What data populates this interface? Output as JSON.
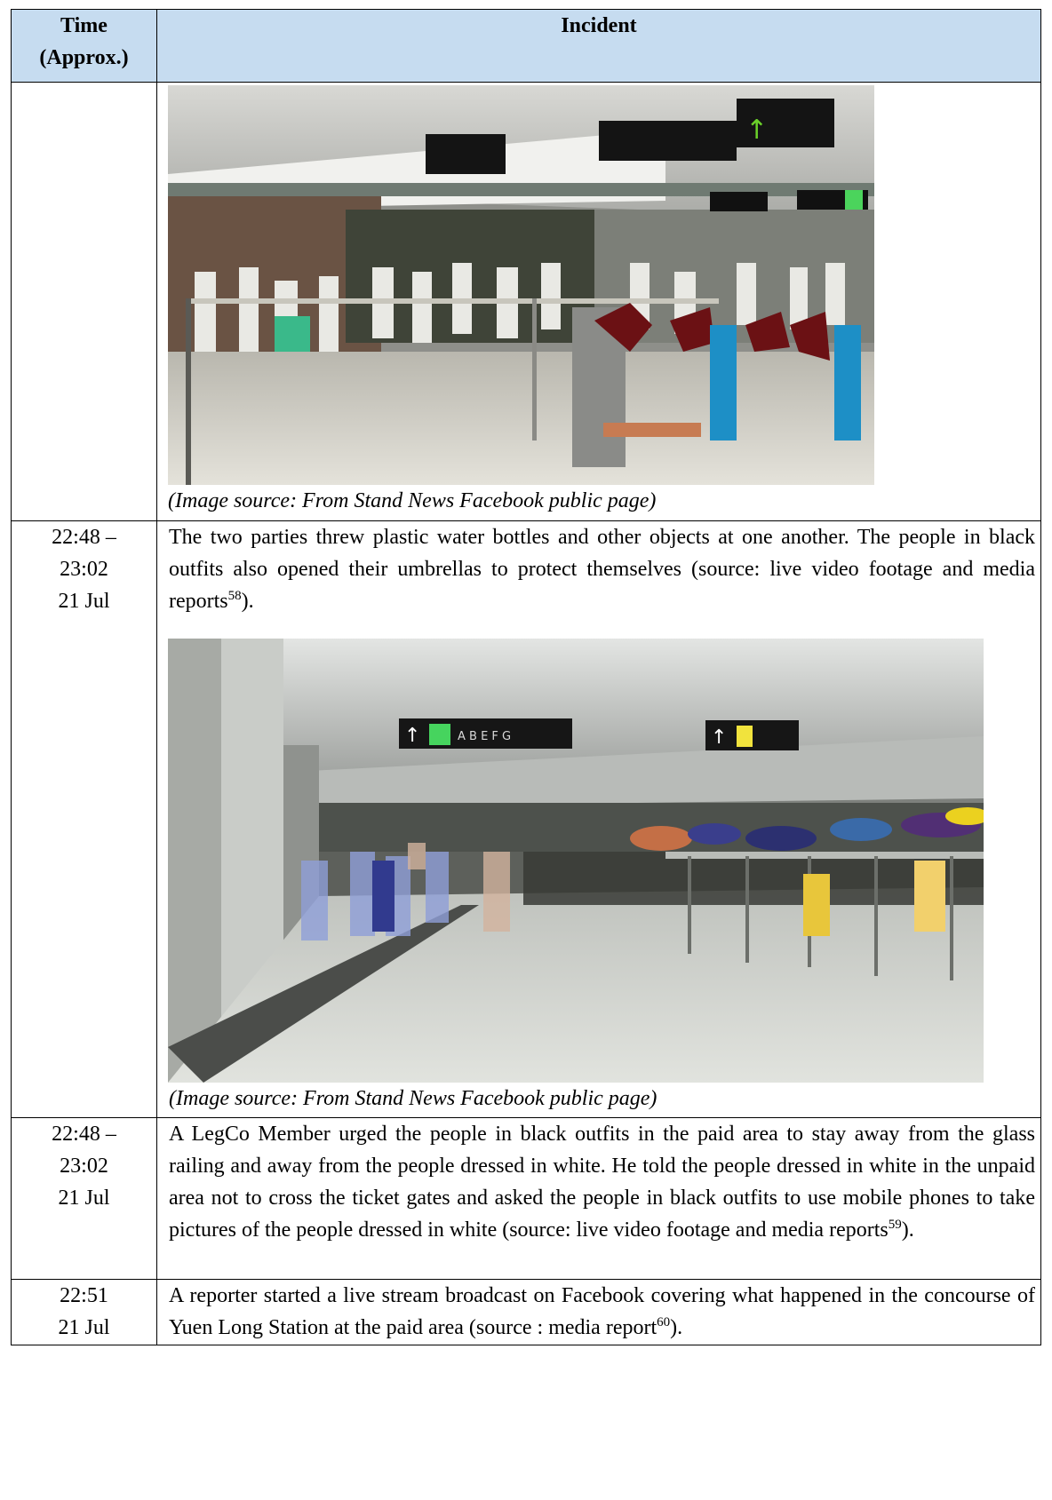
{
  "header": {
    "time_line1": "Time",
    "time_line2": "(Approx.)",
    "incident": "Incident"
  },
  "row0": {
    "caption": "(Image source: From Stand News Facebook public page)"
  },
  "row1": {
    "time": [
      "22:48 –",
      "23:02",
      "21 Jul"
    ],
    "text": "The two parties threw plastic water bottles and other objects at one another.    The people in black outfits also opened their umbrellas to protect themselves (source: live video footage and media reports",
    "ref": "58",
    "tail": ").",
    "caption": "(Image source: From Stand News Facebook public page)",
    "signs": [
      "A B E F G"
    ]
  },
  "row2": {
    "time": [
      "22:48 –",
      "23:02",
      "21 Jul"
    ],
    "text": "A LegCo Member urged the people in black outfits in the paid area to stay away from the glass railing and away from the people dressed in white.    He told the people dressed in white in the unpaid area not to cross the ticket gates and asked the people in black outfits to use mobile phones to take pictures of the people dressed in white (source: live video footage and media reports",
    "ref": "59",
    "tail": ")."
  },
  "row3": {
    "time": [
      "22:51",
      "21 Jul"
    ],
    "text": "A reporter started a live stream broadcast on Facebook covering what happened in the concourse of Yuen Long Station at the paid area (source : media report",
    "ref": "60",
    "tail": ")."
  },
  "colors": {
    "header_bg": "#c6dcf0",
    "border": "#000000"
  }
}
